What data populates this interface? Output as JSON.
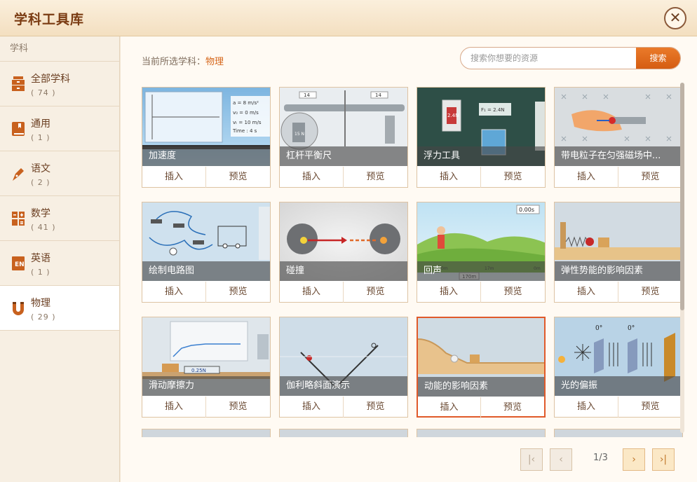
{
  "header": {
    "title": "学科工具库",
    "close_glyph": "✕"
  },
  "sidebar": {
    "heading": "学科",
    "items": [
      {
        "label": "全部学科",
        "count": "( 74 )",
        "icon": "all-subjects-icon"
      },
      {
        "label": "通用",
        "count": "( 1 )",
        "icon": "book-icon"
      },
      {
        "label": "语文",
        "count": "( 2 )",
        "icon": "pen-icon"
      },
      {
        "label": "数学",
        "count": "( 41 )",
        "icon": "calculator-icon"
      },
      {
        "label": "英语",
        "count": "( 1 )",
        "icon": "english-icon"
      },
      {
        "label": "物理",
        "count": "( 29 )",
        "icon": "magnet-icon",
        "active": true
      }
    ]
  },
  "main": {
    "current_prefix": "当前所选学科：",
    "current_subject": "物理",
    "search": {
      "placeholder": "搜索你想要的资源",
      "button": "搜索"
    },
    "card_actions": {
      "insert": "插入",
      "preview": "预览"
    },
    "cards": [
      {
        "title": "加速度"
      },
      {
        "title": "杠杆平衡尺"
      },
      {
        "title": "浮力工具"
      },
      {
        "title": "带电粒子在匀强磁场中..."
      },
      {
        "title": "绘制电路图"
      },
      {
        "title": "碰撞"
      },
      {
        "title": "回声"
      },
      {
        "title": "弹性势能的影响因素"
      },
      {
        "title": "滑动摩擦力"
      },
      {
        "title": "伽利略斜面演示"
      },
      {
        "title": "动能的影响因素",
        "selected": true
      },
      {
        "title": "光的偏振"
      }
    ],
    "thumb_text": {
      "accel": {
        "a": "a = 8  m/s²",
        "v0": "v₀ = 0  m/s",
        "vt": "vₜ = 10  m/s",
        "time": "Time : 4  s"
      },
      "lever": {
        "page_a": "14",
        "page_b": "14",
        "weight": "15 N"
      },
      "buoy": {
        "left": "2.4N",
        "right": "F₁ = 2.4N"
      },
      "echo": {
        "timer": "0.00s",
        "dist": "170m",
        "m0": "0m",
        "m17": "17m",
        "mright": "0m"
      },
      "friction": {
        "reading": "0.25N"
      },
      "polar": {
        "deg1": "0°",
        "deg2": "0°"
      }
    },
    "pager": {
      "info": "1/3",
      "first": "|‹",
      "prev": "‹",
      "next": "›",
      "last": "›|"
    }
  },
  "colors": {
    "accent": "#d6661a",
    "brand_title": "#7a3b12"
  }
}
